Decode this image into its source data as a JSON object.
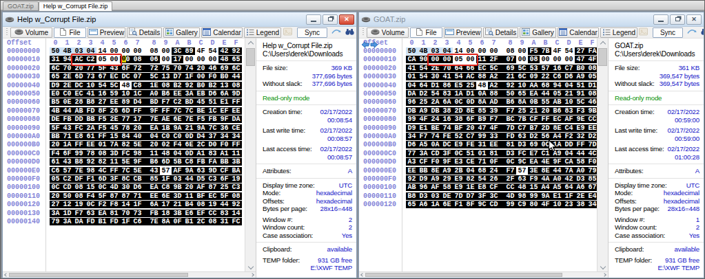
{
  "tabs": [
    {
      "label": "GOAT.zip",
      "active": false
    },
    {
      "label": "Help w_Corrupt File.zip",
      "active": true
    }
  ],
  "toolbar": {
    "buttons": [
      {
        "icon": "volume-icon",
        "label": "Volume",
        "width": 61
      },
      {
        "icon": "file-icon",
        "label": "File",
        "width": 47,
        "pressed": true
      },
      {
        "icon": "preview-icon",
        "label": "Preview",
        "width": 55
      },
      {
        "icon": "details-icon",
        "label": "Details",
        "width": 51
      },
      {
        "icon": "gallery-icon",
        "label": "Gallery",
        "width": 53
      },
      {
        "icon": "calendar-icon",
        "label": "Calendar",
        "width": 60
      },
      {
        "icon": "legend-icon",
        "label": "Legend",
        "width": 54
      }
    ],
    "sync_label": "Sync"
  },
  "hex_header": {
    "offset_label": "Offset",
    "cols": [
      "0",
      "1",
      "2",
      "3",
      "4",
      "5",
      "6",
      "7",
      "8",
      "9",
      "A",
      "B",
      "C",
      "D",
      "E",
      "F"
    ]
  },
  "windows": [
    {
      "title": "Help w_Corrupt File.zip",
      "active": true,
      "nav_arrows": false,
      "rows": [
        {
          "o": "00000000",
          "b": "50 4B 03 04 14 00 00 00 08 00 3C 89 4F 54 42 92"
        },
        {
          "o": "00000010",
          "b": "31 94 AC C2 05 00 00 08 06 00 17 00 00 00 48 65"
        },
        {
          "o": "00000020",
          "b": "6C 70 20 77 5F 43 6F 72 72 75 70 74 20 46 69 6C"
        },
        {
          "o": "00000030",
          "b": "65 2E 6D 73 67 EC DC 07 5C 13 D7 1F 00 F0 B0 44"
        },
        {
          "o": "00000040",
          "b": "D9 2E DC 10 54 5C 48 C8 1E 08 B2 92 B0 B2 13 08"
        },
        {
          "o": "00000050",
          "b": "E0 C0 EC 41 16 59 10 1C A0 B6 EE 3A EB D6 6A 9D"
        },
        {
          "o": "00000060",
          "b": "B5 0E 28 B8 27 EE 89 D4 BD F7 C2 BD 45 51 E1 FF"
        },
        {
          "o": "00000070",
          "b": "4B 44 AB FD 8F 26 6D FF 9F FF 7C 7C BE 1C EF EE"
        },
        {
          "o": "00000080",
          "b": "DE FB DD BB F5 2E 77 17 7E AE 6E 7E F5 FB 9F DA"
        },
        {
          "o": "00000090",
          "b": "5F 43 FC 2A F5 45 78 20 EA 1B 9A 21 9A 7C 36 CE"
        },
        {
          "o": "000000A0",
          "b": "BB 71 E8 61 FF 15 84 40 04 C0 C0 0D D4 37 34 34"
        },
        {
          "o": "000000B0",
          "b": "20 1A FF EE 01 7A 82 5E 20 02 F4 6E 2C D0 F0 FF"
        },
        {
          "o": "000000C0",
          "b": "F4 6F 99 78 08 3D FC 98 11 48 04 0D A1 83 A1 11"
        },
        {
          "o": "000000D0",
          "b": "61 43 B8 92 82 11 5E 9F B6 6D 5B C8 FB FA BB 3B"
        },
        {
          "o": "000000E0",
          "b": "C6 57 7E 98 4C FF 7C 5E 43 57 AF 9A 63 9D CF BA"
        },
        {
          "o": "000000F0",
          "b": "05 C2 DF F1 6D 3F 8C CB 85 1F 03 44 D5 C3 6F 19"
        },
        {
          "o": "00000100",
          "b": "0C CD 08 15 0C 4D 30 D6 EA C8 9B 20 AF 87 25 C3"
        },
        {
          "o": "00000110",
          "b": "20 50 08 F4 5F 87 87 71 EE 6E 3D 11 BF EC 5F 08"
        },
        {
          "o": "00000120",
          "b": "27 12 19 0C F2 F8 14 1F 6A 17 21 B4 08 19 44 92"
        },
        {
          "o": "00000130",
          "b": "3A 1D F7 63 EA 81 70 73 FB 18 3B E6 EF CC 83 14"
        },
        {
          "o": "00000140",
          "b": "79 3A DA FD B1 FD 1F C6 7E 8A 0F B1 2C 08 31 FC"
        }
      ],
      "states": {
        "0": {
          "blue": [
            0,
            1,
            2,
            3
          ],
          "white": [
            4,
            5,
            6,
            7,
            8,
            9,
            12,
            13
          ]
        },
        "1": {
          "white": [
            4,
            5,
            9,
            11,
            12,
            13
          ]
        },
        "4": {
          "white": [
            6
          ]
        },
        "14": {
          "white": [
            9
          ]
        }
      },
      "redbox": {
        "row": 1,
        "c1": 2,
        "c2": 5
      },
      "caret": {
        "row": 1,
        "col": 6,
        "ch": "0"
      },
      "panel": [
        {
          "t": "name",
          "l": "Help w_Corrupt File.zip"
        },
        {
          "t": "name",
          "l": "C:\\Users\\derek\\Downloads"
        },
        {
          "t": "sep"
        },
        {
          "t": "kv",
          "l": "File size:",
          "v": "369 KB"
        },
        {
          "t": "kv",
          "l": "",
          "v": "377,696 bytes"
        },
        {
          "t": "kv",
          "l": "Without slack:",
          "v": "377,696 bytes"
        },
        {
          "t": "sep"
        },
        {
          "t": "green",
          "l": "Read-only mode"
        },
        {
          "t": "sep"
        },
        {
          "t": "kv",
          "l": "Creation time:",
          "v": "02/17/2022"
        },
        {
          "t": "kv",
          "l": "",
          "v": "00:08:54"
        },
        {
          "t": "gap"
        },
        {
          "t": "kv",
          "l": "Last write time:",
          "v": "02/17/2022"
        },
        {
          "t": "kv",
          "l": "",
          "v": "00:08:57"
        },
        {
          "t": "gap"
        },
        {
          "t": "kv",
          "l": "Last access time:",
          "v": "02/17/2022"
        },
        {
          "t": "kv",
          "l": "",
          "v": "00:08:57"
        },
        {
          "t": "sep"
        },
        {
          "t": "kv",
          "l": "Attributes:",
          "v": "A"
        },
        {
          "t": "sep"
        },
        {
          "t": "kv",
          "l": "Display time zone:",
          "v": "UTC"
        },
        {
          "t": "kv",
          "l": "Mode:",
          "v": "hexadecimal"
        },
        {
          "t": "kv",
          "l": "Offsets:",
          "v": "hexadecimal"
        },
        {
          "t": "kv",
          "l": "Bytes per page:",
          "v": "28x16=448"
        },
        {
          "t": "gap"
        },
        {
          "t": "kv",
          "l": "Window #:",
          "v": "2"
        },
        {
          "t": "kv",
          "l": "Window count:",
          "v": "2"
        },
        {
          "t": "kv",
          "l": "Case association:",
          "v": "Yes"
        },
        {
          "t": "sep"
        },
        {
          "t": "kv",
          "l": "Clipboard:",
          "v": "available"
        },
        {
          "t": "gap"
        },
        {
          "t": "kv",
          "l": "TEMP folder:",
          "v": "931 GB free"
        },
        {
          "t": "kv",
          "l": "",
          "v": "E:\\XWF TEMP"
        }
      ]
    },
    {
      "title": "GOAT.zip",
      "active": false,
      "nav_arrows": true,
      "rows": [
        {
          "o": "00000000",
          "b": "50 4B 03 04 14 00 00 00 08 00 F5 7B 4F 54 27 FA"
        },
        {
          "o": "00000010",
          "b": "CA 90 00 00 05 00 11 2F 07 00 08 00 00 00 47 4F"
        },
        {
          "o": "00000020",
          "b": "41 54 2E 70 64 66 EC 5C 69 5C 53 57 16 C7 B0 08"
        },
        {
          "o": "00000030",
          "b": "01 54 30 41 54 AC 88 A2 21 6C 09 22 C6 D6 A9 05"
        },
        {
          "o": "00000040",
          "b": "04 64 D1 86 E5 25 48 A2 92 10 AA 68 94 04 51 D1"
        },
        {
          "o": "00000050",
          "b": "DA D2 54 83 1A D1 0A 88 50 65 EA 44 05 21 91 08"
        },
        {
          "o": "00000060",
          "b": "96 25 2A 6A 0C 0D 8A AD B6 8A 0B 55 AB 10 5C 46"
        },
        {
          "o": "00000070",
          "b": "DB A9 DB 38 2D 8E 85 39 F7 25 21 20 B6 83 F3 9B"
        },
        {
          "o": "00000080",
          "b": "99 4F 24 16 38 6F B9 F7 BC 7B CF FF EC AF 9E CC"
        },
        {
          "o": "00000090",
          "b": "D9 E1 BE 74 BF 20 47 4F 7D C7 B7 2D 8E C4 E9 EE"
        },
        {
          "o": "000000A0",
          "b": "34 F7 74 FE 52 C7 99 33 FD 63 D2 56 A4 F2 32 D2"
        },
        {
          "o": "000000B0",
          "b": "D6 A5 0A DC E9 FE 31 EE 81 D3 69 0C 1A DD FF 7D"
        },
        {
          "o": "000000C0",
          "b": "77 3A CD 3F 0C 51 01 81 D3 FC E7 C1 A9 04 44 4C"
        },
        {
          "o": "000000D0",
          "b": "A3 CF F0 9F E3 CE 71 0F 0C 9C EA 4E 9F CA 58 F0"
        },
        {
          "o": "000000E0",
          "b": "EE BB 8E A9 2B 04 68 24 F7 57 3E 8E 44 7A A0 79"
        },
        {
          "o": "000000F0",
          "b": "92 D9 A9 29 E9 82 54 26 2F 63 F9 4A A0 42 D3 85"
        },
        {
          "o": "00000100",
          "b": "AB 96 AF 58 E9 1E E8 CF CC 48 15 A4 A5 64 A6 67"
        },
        {
          "o": "00000110",
          "b": "B8 D3 03 DE 7D D7 3F 3C 4D 98 99 9A E1 1F 2E E4"
        },
        {
          "o": "00000120",
          "b": "65 A6 1A 6E F1 8F 9C CD 99 C9 80 4F 10 23 38 34"
        }
      ],
      "states": {
        "0": {
          "blue": [
            0,
            1,
            2,
            3
          ],
          "white": [
            4,
            5,
            6,
            7,
            8,
            9,
            12,
            13
          ]
        },
        "1": {
          "white": [
            4,
            5,
            9,
            11,
            12,
            13
          ]
        },
        "4": {
          "white": [
            6
          ]
        },
        "14": {
          "white": [
            9
          ]
        }
      },
      "redbox": {
        "row": 1,
        "c1": 2,
        "c2": 5
      },
      "panel": [
        {
          "t": "name",
          "l": "GOAT.zip"
        },
        {
          "t": "name",
          "l": "C:\\Users\\derek\\Downloads"
        },
        {
          "t": "sep"
        },
        {
          "t": "kv",
          "l": "File size:",
          "v": "361 KB"
        },
        {
          "t": "kv",
          "l": "",
          "v": "369,547 bytes"
        },
        {
          "t": "kv",
          "l": "Without slack:",
          "v": "369,547 bytes"
        },
        {
          "t": "sep"
        },
        {
          "t": "green",
          "l": "Read-only mode"
        },
        {
          "t": "sep"
        },
        {
          "t": "kv",
          "l": "Creation time:",
          "v": "02/17/2022"
        },
        {
          "t": "kv",
          "l": "",
          "v": "00:59:00"
        },
        {
          "t": "gap"
        },
        {
          "t": "kv",
          "l": "Last write time:",
          "v": "02/17/2022"
        },
        {
          "t": "kv",
          "l": "",
          "v": "00:59:00"
        },
        {
          "t": "gap"
        },
        {
          "t": "kv",
          "l": "Last access time:",
          "v": "02/17/2022"
        },
        {
          "t": "kv",
          "l": "",
          "v": "01:00:28"
        },
        {
          "t": "sep"
        },
        {
          "t": "kv",
          "l": "Attributes:",
          "v": "A"
        },
        {
          "t": "sep"
        },
        {
          "t": "kv",
          "l": "Display time zone:",
          "v": "UTC"
        },
        {
          "t": "kv",
          "l": "Mode:",
          "v": "hexadecimal"
        },
        {
          "t": "kv",
          "l": "Offsets:",
          "v": "hexadecimal"
        },
        {
          "t": "kv",
          "l": "Bytes per page:",
          "v": "28x16=448"
        },
        {
          "t": "gap"
        },
        {
          "t": "kv",
          "l": "Window #:",
          "v": "1"
        },
        {
          "t": "kv",
          "l": "Window count:",
          "v": "2"
        },
        {
          "t": "kv",
          "l": "Case association:",
          "v": "Yes"
        },
        {
          "t": "sep"
        },
        {
          "t": "kv",
          "l": "Clipboard:",
          "v": "available"
        },
        {
          "t": "gap"
        },
        {
          "t": "kv",
          "l": "TEMP folder:",
          "v": "931 GB free"
        },
        {
          "t": "kv",
          "l": "",
          "v": "E:\\XWF TEMP"
        }
      ]
    }
  ]
}
